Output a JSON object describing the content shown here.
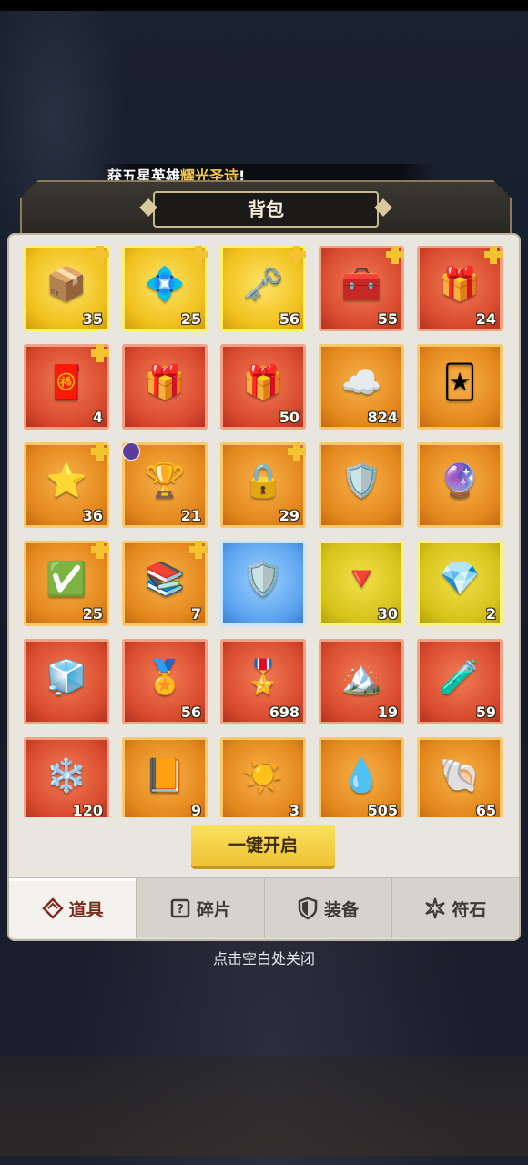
{
  "banner": {
    "prefix": "获五星英雄",
    "highlight": "耀光圣诗",
    "suffix": "!"
  },
  "title": "背包",
  "items": [
    {
      "name": "jade-chest-icon",
      "rarity": "gold",
      "count": "35",
      "badge": true,
      "glyph": "📦"
    },
    {
      "name": "crystal-chest-icon",
      "rarity": "gold",
      "count": "25",
      "badge": true,
      "glyph": "💠"
    },
    {
      "name": "winged-chest-icon",
      "rarity": "gold",
      "count": "56",
      "badge": true,
      "glyph": "🗝️"
    },
    {
      "name": "star-chest-icon",
      "rarity": "red",
      "count": "55",
      "badge": true,
      "glyph": "🧰"
    },
    {
      "name": "jade-red-chest-icon",
      "rarity": "red",
      "count": "24",
      "badge": true,
      "glyph": "🎁"
    },
    {
      "name": "select-chest-icon",
      "rarity": "red",
      "count": "4",
      "badge": true,
      "glyph": "🧧"
    },
    {
      "name": "gold-red-chest-icon",
      "rarity": "red",
      "count": "",
      "badge": false,
      "glyph": "🎁"
    },
    {
      "name": "gold-red-chest-2-icon",
      "rarity": "red",
      "count": "50",
      "badge": false,
      "glyph": "🎁"
    },
    {
      "name": "cloud-chest-icon",
      "rarity": "orange",
      "count": "824",
      "badge": false,
      "glyph": "☁️"
    },
    {
      "name": "red-card-icon",
      "rarity": "orange",
      "count": "",
      "badge": false,
      "glyph": "🃏"
    },
    {
      "name": "silver-star-chest-icon",
      "rarity": "orange",
      "count": "36",
      "badge": true,
      "glyph": "⭐"
    },
    {
      "name": "winged-purple-chest-icon",
      "rarity": "orange",
      "count": "21",
      "badge": false,
      "tag": true,
      "glyph": "🏆"
    },
    {
      "name": "silver-jade-chest-icon",
      "rarity": "orange",
      "count": "29",
      "badge": true,
      "glyph": "🔒"
    },
    {
      "name": "gold-card-icon",
      "rarity": "orange",
      "count": "",
      "badge": false,
      "glyph": "🛡️"
    },
    {
      "name": "purple-card-icon",
      "rarity": "orange",
      "count": "",
      "badge": false,
      "glyph": "🔮"
    },
    {
      "name": "select-gold-chest-icon",
      "rarity": "orange",
      "count": "25",
      "badge": true,
      "glyph": "✅"
    },
    {
      "name": "book-chest-icon",
      "rarity": "orange",
      "count": "7",
      "badge": true,
      "glyph": "📚"
    },
    {
      "name": "rune-chest-icon",
      "rarity": "blue",
      "count": "",
      "badge": false,
      "glyph": "🛡️"
    },
    {
      "name": "purple-gem-icon",
      "rarity": "yellow",
      "count": "30",
      "badge": false,
      "glyph": "🔻"
    },
    {
      "name": "blue-cube-gem-icon",
      "rarity": "yellow",
      "count": "2",
      "badge": false,
      "glyph": "💎"
    },
    {
      "name": "crystal-cube-icon",
      "rarity": "red",
      "count": "",
      "badge": false,
      "glyph": "🧊"
    },
    {
      "name": "red-medal-icon",
      "rarity": "red",
      "count": "56",
      "badge": false,
      "glyph": "🏅"
    },
    {
      "name": "green-medal-icon",
      "rarity": "red",
      "count": "698",
      "badge": false,
      "glyph": "🎖️"
    },
    {
      "name": "crystal-dust-icon",
      "rarity": "red",
      "count": "19",
      "badge": false,
      "glyph": "🏔️"
    },
    {
      "name": "potion-icon",
      "rarity": "red",
      "count": "59",
      "badge": false,
      "glyph": "🧪"
    },
    {
      "name": "crystal-flower-icon",
      "rarity": "red",
      "count": "120",
      "badge": false,
      "glyph": "❄️"
    },
    {
      "name": "gear-book-icon",
      "rarity": "orange",
      "count": "9",
      "badge": false,
      "glyph": "📙"
    },
    {
      "name": "sun-badge-icon",
      "rarity": "orange",
      "count": "3",
      "badge": false,
      "glyph": "☀️"
    },
    {
      "name": "water-drop-icon",
      "rarity": "orange",
      "count": "505",
      "badge": false,
      "glyph": "💧"
    },
    {
      "name": "pearl-shell-icon",
      "rarity": "orange",
      "count": "65",
      "badge": false,
      "glyph": "🐚"
    }
  ],
  "open_all_label": "一键开启",
  "tabs": [
    {
      "label": "道具",
      "icon": "bag-icon",
      "active": true
    },
    {
      "label": "碎片",
      "icon": "fragment-icon",
      "active": false
    },
    {
      "label": "装备",
      "icon": "shield-icon",
      "active": false
    },
    {
      "label": "符石",
      "icon": "rune-icon",
      "active": false
    }
  ],
  "close_hint": "点击空白处关闭",
  "colors": {
    "accent": "#f2c64a",
    "active_tab_text": "#7b2d1f",
    "button": "#eec234"
  }
}
